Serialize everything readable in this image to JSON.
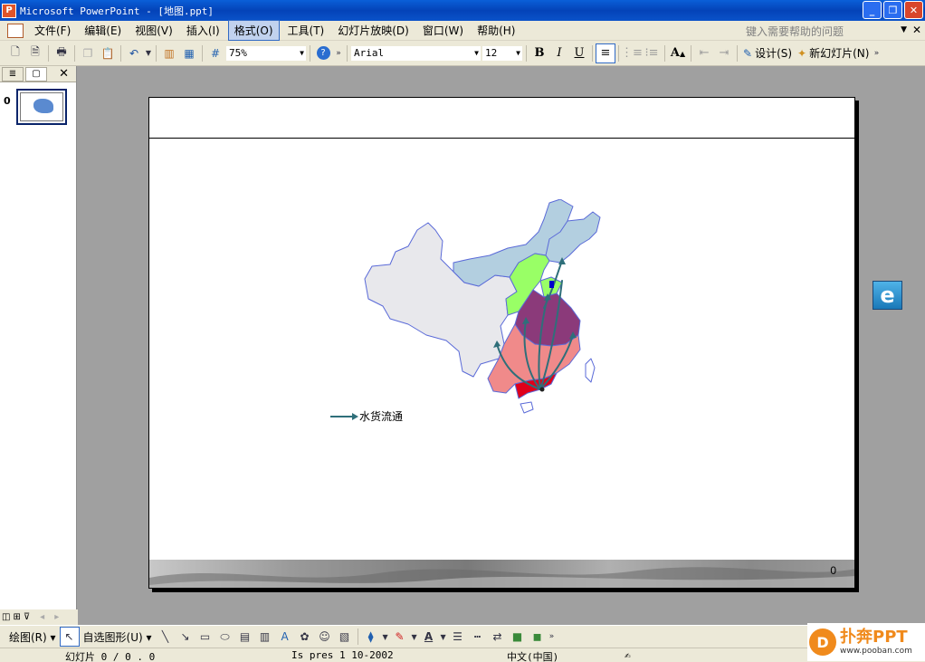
{
  "window": {
    "title": "Microsoft PowerPoint - [地图.ppt]"
  },
  "menubar": {
    "items": [
      "文件(F)",
      "编辑(E)",
      "视图(V)",
      "插入(I)",
      "格式(O)",
      "工具(T)",
      "幻灯片放映(D)",
      "窗口(W)",
      "帮助(H)"
    ],
    "active_index": 4,
    "help_placeholder": "键入需要帮助的问题"
  },
  "toolbar": {
    "zoom": "75%",
    "font": "Arial",
    "font_size": "12",
    "bold": "B",
    "italic": "I",
    "underline": "U",
    "design_label": "设计(S)",
    "new_slide_label": "新幻灯片(N)"
  },
  "slides_pane": {
    "thumb_number": "0"
  },
  "slide": {
    "number": "0",
    "legend_label": "水货流通"
  },
  "drawing_toolbar": {
    "draw_label": "绘图(R)",
    "autoshape_label": "自选图形(U)"
  },
  "statusbar": {
    "slide_info": "幻灯片 0 / 0 . 0",
    "template": "Is pres 1 10-2002",
    "language": "中文(中国)"
  },
  "watermark": {
    "title": "扑奔PPT",
    "url": "www.pooban.com"
  },
  "colors": {
    "northeast": "#b3cfe0",
    "north": "#99ff66",
    "east": "#8b3a7a",
    "south": "#f08a8a",
    "guangdong": "#e0001a",
    "west": "#e8e8ec",
    "border": "#5a6ad8",
    "arrow": "#2f6f7a"
  }
}
